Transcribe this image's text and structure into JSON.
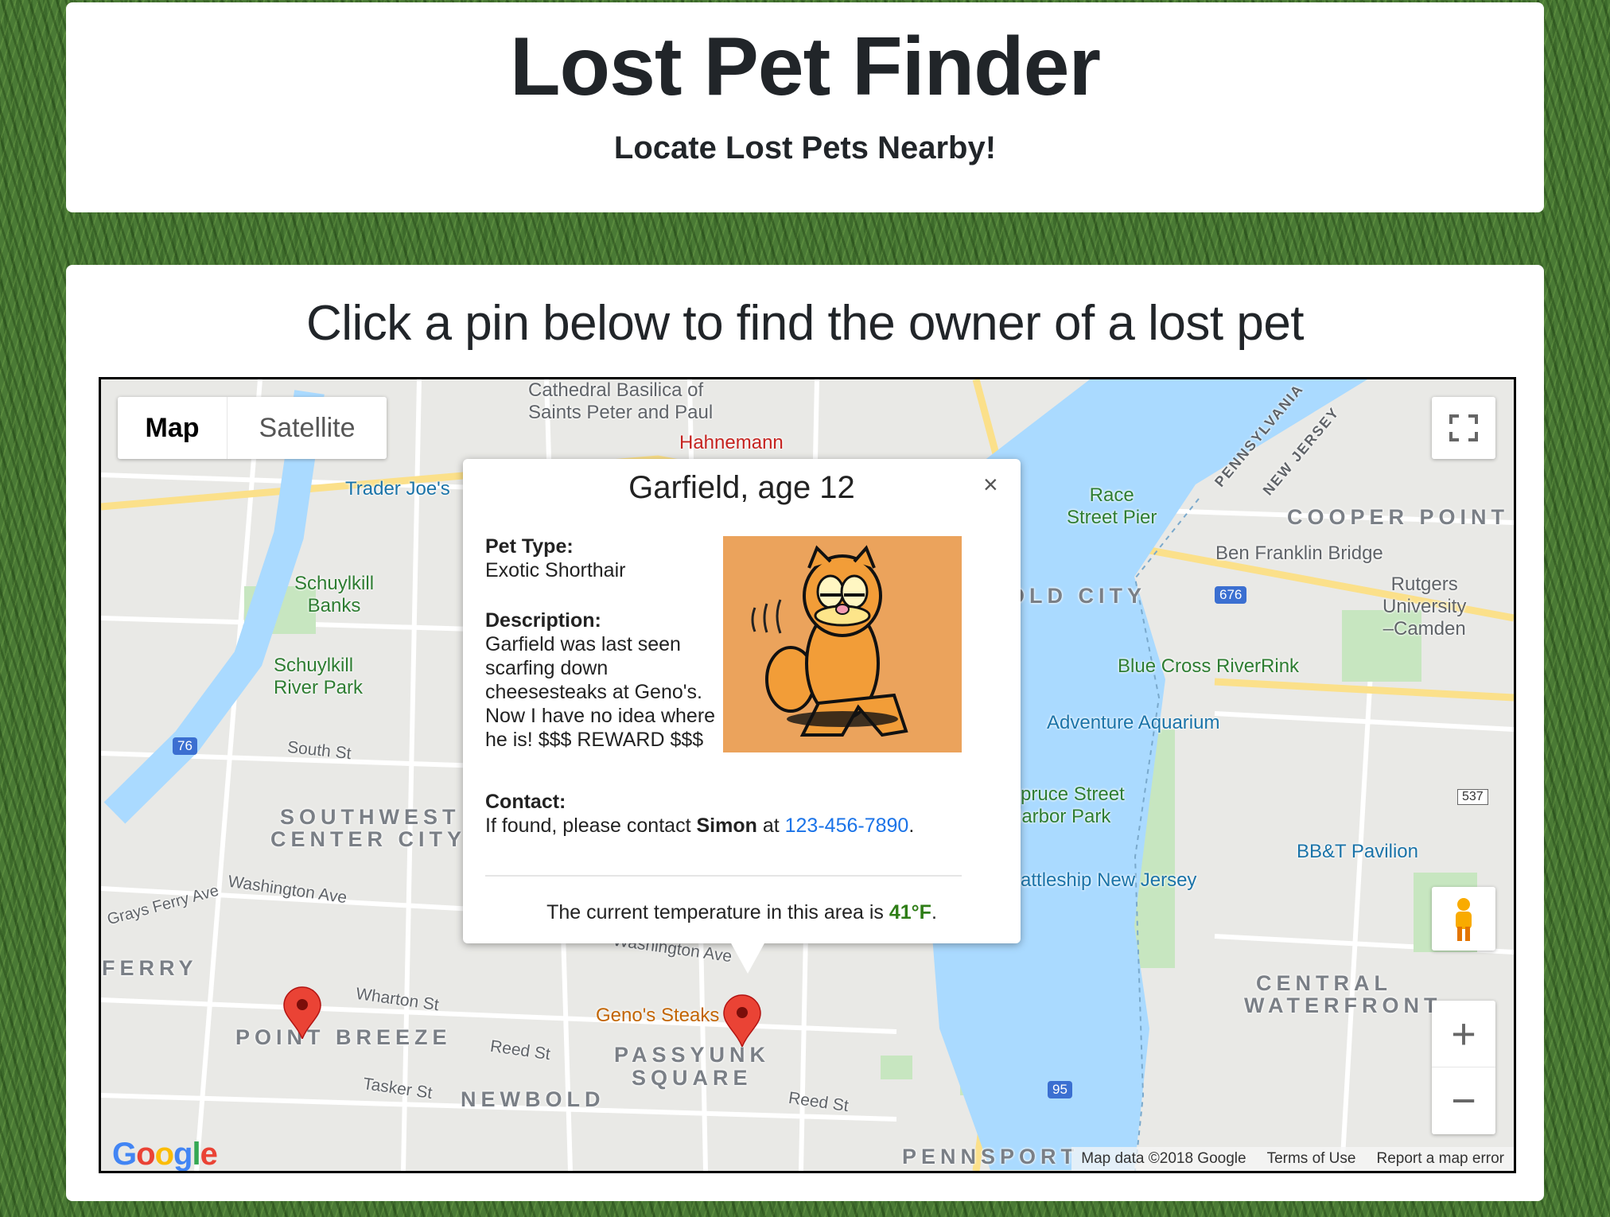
{
  "header": {
    "title": "Lost Pet Finder",
    "subtitle": "Locate Lost Pets Nearby!"
  },
  "main": {
    "instruction": "Click a pin below to find the owner of a lost pet"
  },
  "map": {
    "map_type": {
      "map": "Map",
      "satellite": "Satellite",
      "selected": "Map"
    },
    "footer": {
      "data": "Map data ©2018 Google",
      "terms": "Terms of Use",
      "report": "Report a map error"
    },
    "logo": "Google",
    "zoom_in": "+",
    "zoom_out": "−",
    "labels": {
      "cathedral": "Cathedral Basilica of",
      "cathedral2": "Saints Peter and Paul",
      "hahnemann": "Hahnemann",
      "traderjoes": "Trader Joe's",
      "schuylkill_banks": "Schuylkill",
      "schuylkill_banks2": "Banks",
      "schuylkill_park": "Schuylkill",
      "schuylkill_park2": "River Park",
      "south_st": "South St",
      "southwest": "SOUTHWEST",
      "center_city": "CENTER CITY",
      "washington_w": "Washington Ave",
      "grays_ferry": "Grays Ferry Ave",
      "ferry": "FERRY",
      "wharton": "Wharton St",
      "point_breeze": "POINT BREEZE",
      "reed_w": "Reed St",
      "tasker": "Tasker St",
      "newbold": "NEWBOLD",
      "genos": "Geno's Steaks",
      "passyunk": "PASSYUNK",
      "square": "SQUARE",
      "reed_e": "Reed St",
      "washington_m": "Washington Ave",
      "race": "Race",
      "race2": "Street Pier",
      "old_city": "OLD CITY",
      "ben_franklin": "Ben Franklin Bridge",
      "cooper": "COOPER POINT",
      "rutgers": "Rutgers",
      "rutgers2": "University",
      "rutgers3": "–Camden",
      "riverrink": "Blue Cross RiverRink",
      "aquarium": "Adventure Aquarium",
      "spruce": "Spruce Street",
      "spruce2": "Harbor Park",
      "bbt": "BB&T Pavilion",
      "battleship": "Battleship New Jersey",
      "central": "CENTRAL",
      "waterfront": "WATERFRONT",
      "pennsport": "PENNSPORT",
      "pa": "PENNSYLVANIA",
      "nj": "NEW JERSEY",
      "i676": "676",
      "i95": "95",
      "i76": "76",
      "r537": "537"
    },
    "pins": [
      {
        "name": "Point Breeze pin"
      },
      {
        "name": "Garfield pin",
        "selected": true
      }
    ]
  },
  "popup": {
    "title": "Garfield, age 12",
    "close": "×",
    "pet_type_label": "Pet Type:",
    "pet_type": "Exotic Shorthair",
    "description_label": "Description:",
    "description": "Garfield was last seen scarfing down cheesesteaks at Geno's. Now I have no idea where he is! $$$ REWARD $$$",
    "contact_label": "Contact:",
    "contact_prefix": "If found, please contact ",
    "contact_name": "Simon",
    "contact_mid": " at ",
    "phone": "123-456-7890",
    "contact_end": ".",
    "temp_prefix": "The current temperature in this area is ",
    "temperature": "41°F",
    "temp_end": "."
  },
  "colors": {
    "pin": "#ea4335",
    "link": "#1a73e8",
    "temp": "#2e7d16",
    "water": "#aadaff"
  }
}
